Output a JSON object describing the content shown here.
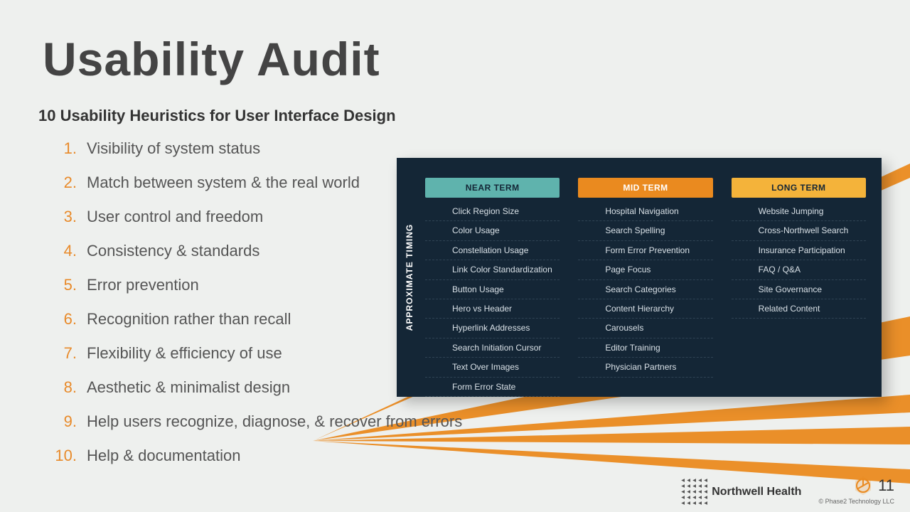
{
  "title": "Usability Audit",
  "subtitle": "10 Usability Heuristics for User Interface Design",
  "heuristics": [
    "Visibility of system status",
    "Match between system & the real world",
    "User control and freedom",
    "Consistency & standards",
    "Error prevention",
    "Recognition rather than recall",
    "Flexibility & efficiency of use",
    "Aesthetic & minimalist design",
    "Help users recognize, diagnose, & recover from errors",
    "Help & documentation"
  ],
  "board": {
    "side_label": "APPROXIMATE TIMING",
    "columns": [
      {
        "header": "NEAR TERM",
        "style": "near",
        "items": [
          "Click Region Size",
          "Color Usage",
          "Constellation Usage",
          "Link Color Standardization",
          "Button Usage",
          "Hero vs Header",
          "Hyperlink Addresses",
          "Search Initiation Cursor",
          "Text Over Images",
          "Form Error State"
        ]
      },
      {
        "header": "MID TERM",
        "style": "mid",
        "items": [
          "Hospital Navigation",
          "Search Spelling",
          "Form Error Prevention",
          "Page Focus",
          "Search Categories",
          "Content Hierarchy",
          "Carousels",
          "Editor Training",
          "Physician Partners"
        ]
      },
      {
        "header": "LONG TERM",
        "style": "long",
        "items": [
          "Website Jumping",
          "Cross-Northwell Search",
          "Insurance Participation",
          "FAQ / Q&A",
          "Site Governance",
          "Related Content"
        ]
      }
    ]
  },
  "footer": {
    "brand": "Northwell Health",
    "page": "11",
    "copyright": "© Phase2 Technology LLC"
  },
  "colors": {
    "accent": "#ea8a1f",
    "near": "#5fb3ad",
    "mid": "#ea8a1f",
    "long": "#f4b33a",
    "board_bg": "#142636"
  }
}
